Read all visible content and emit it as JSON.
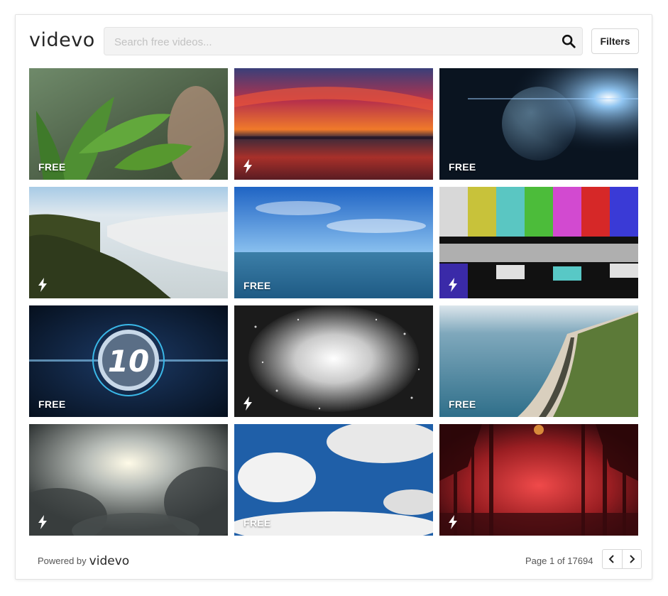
{
  "brand": {
    "logo_text": "videvo"
  },
  "search": {
    "placeholder": "Search free videos...",
    "value": ""
  },
  "toolbar": {
    "filters_label": "Filters"
  },
  "tiles": [
    {
      "label": "FREE",
      "license": "free",
      "subject": "green leaves in rain"
    },
    {
      "label": "",
      "license": "premium",
      "subject": "red sunset over ocean"
    },
    {
      "label": "FREE",
      "license": "free",
      "subject": "earth from space with sun flare"
    },
    {
      "label": "",
      "license": "premium",
      "subject": "misty forest valley aerial"
    },
    {
      "label": "FREE",
      "license": "free",
      "subject": "blue sky over ocean waves"
    },
    {
      "label": "",
      "license": "premium",
      "subject": "tv color bars static"
    },
    {
      "label": "FREE",
      "license": "free",
      "subject": "countdown number 10"
    },
    {
      "label": "",
      "license": "premium",
      "subject": "glowing heart particles"
    },
    {
      "label": "FREE",
      "license": "free",
      "subject": "tropical coastline aerial"
    },
    {
      "label": "",
      "license": "premium",
      "subject": "sun through storm clouds"
    },
    {
      "label": "FREE",
      "license": "free",
      "subject": "white clouds blue sky"
    },
    {
      "label": "",
      "license": "premium",
      "subject": "red foggy forest"
    }
  ],
  "footer": {
    "powered_by": "Powered by",
    "powered_logo": "videvo",
    "page_info": "Page 1 of 17694"
  },
  "colors": {
    "badge_text": "#ffffff",
    "border": "#e2e2e2"
  }
}
